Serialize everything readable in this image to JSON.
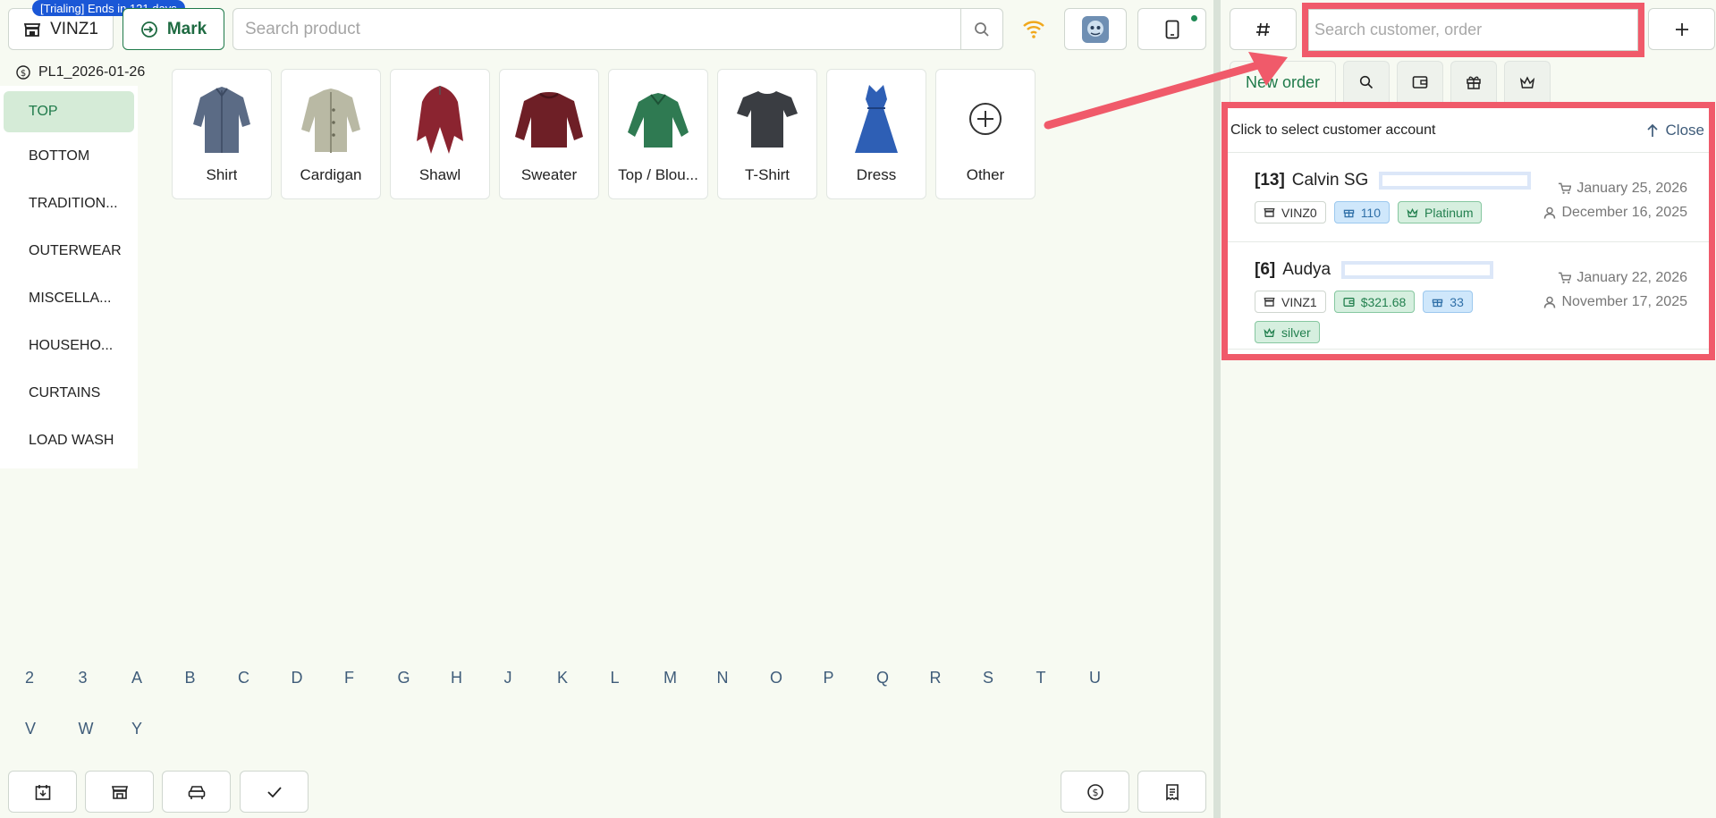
{
  "trial_badge": "[Trialing] Ends in 121 days",
  "header": {
    "store_label": "VINZ1",
    "mark_label": "Mark",
    "search_placeholder": "Search product"
  },
  "pricelist": "PL1_2026-01-26",
  "categories": [
    "TOP",
    "BOTTOM",
    "TRADITION...",
    "OUTERWEAR",
    "MISCELLA...",
    "HOUSEHO...",
    "CURTAINS",
    "LOAD WASH"
  ],
  "products": [
    {
      "label": "Shirt",
      "icon": "shirt-icon",
      "color": "#5b6b85"
    },
    {
      "label": "Cardigan",
      "icon": "cardigan-icon",
      "color": "#b9b9a4"
    },
    {
      "label": "Shawl",
      "icon": "shawl-icon",
      "color": "#8b2430"
    },
    {
      "label": "Sweater",
      "icon": "sweater-icon",
      "color": "#6e1f26"
    },
    {
      "label": "Top / Blou...",
      "icon": "blouse-icon",
      "color": "#2f7a52"
    },
    {
      "label": "T-Shirt",
      "icon": "tshirt-icon",
      "color": "#3a3d42"
    },
    {
      "label": "Dress",
      "icon": "dress-icon",
      "color": "#2e5fb5"
    },
    {
      "label": "Other",
      "icon": "add-circle-icon",
      "color": "#333333"
    }
  ],
  "alphabet": [
    "2",
    "3",
    "A",
    "B",
    "C",
    "D",
    "F",
    "G",
    "H",
    "J",
    "K",
    "L",
    "M",
    "N",
    "O",
    "P",
    "Q",
    "R",
    "S",
    "T",
    "U",
    "V",
    "W",
    "Y"
  ],
  "right": {
    "search_placeholder": "Search customer, order",
    "tab_new_order": "New order",
    "panel_title": "Click to select customer account",
    "close_label": "Close",
    "customers": [
      {
        "id": "[13]",
        "name": "Calvin SG",
        "store": "VINZ0",
        "points": "110",
        "tier": "Platinum",
        "last_order": "January 25, 2026",
        "joined": "December 16, 2025"
      },
      {
        "id": "[6]",
        "name": "Audya",
        "store": "VINZ1",
        "balance": "$321.68",
        "points": "33",
        "tier": "silver",
        "last_order": "January 22, 2026",
        "joined": "November 17, 2025"
      }
    ]
  },
  "colors": {
    "accent_green": "#1f7a4a",
    "highlight_red": "#f05a6a",
    "trial_blue": "#1a57d6"
  }
}
